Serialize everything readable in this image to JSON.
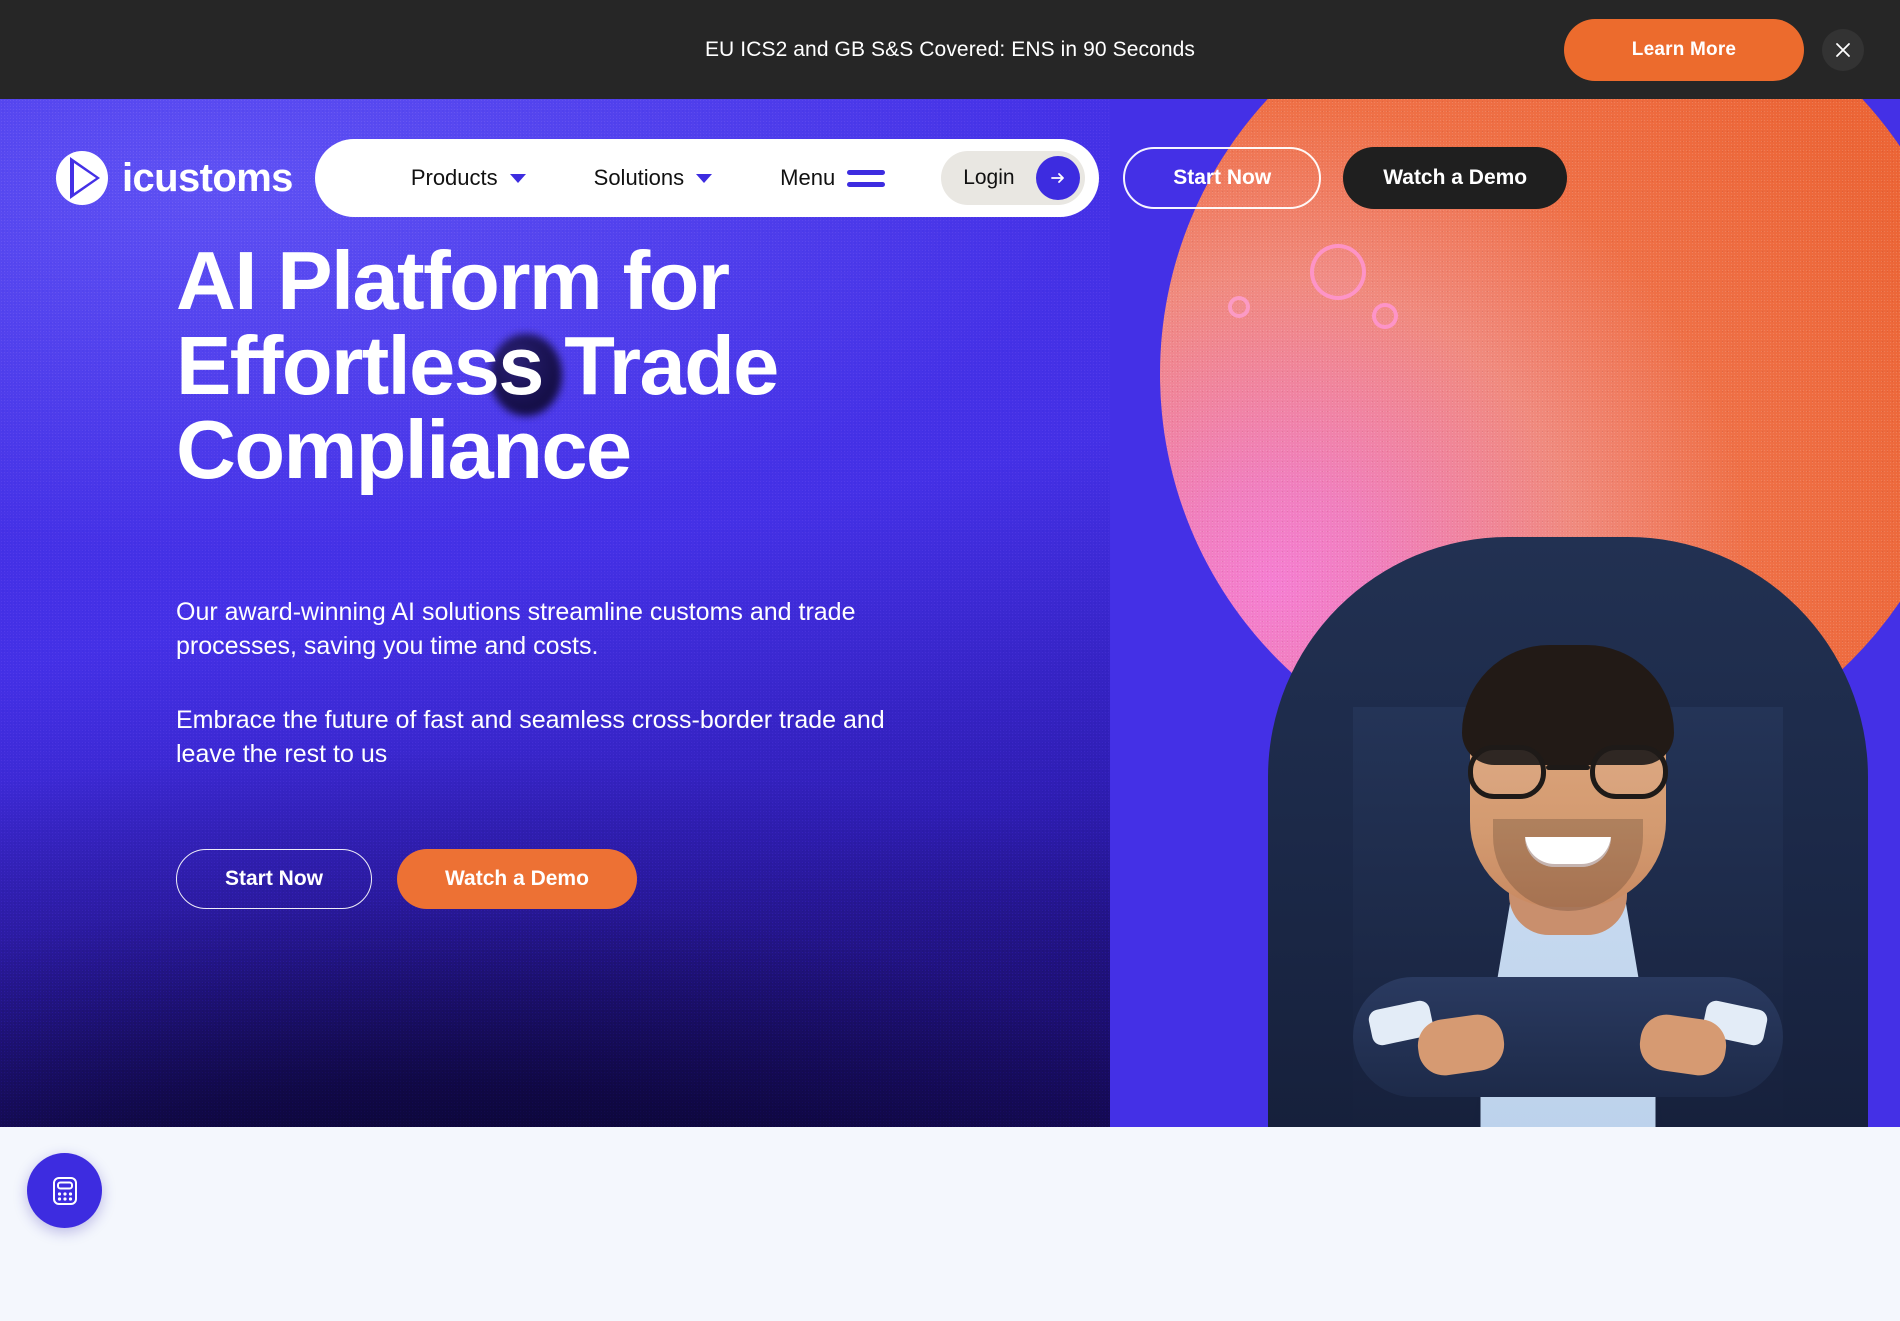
{
  "banner": {
    "message": "EU ICS2 and GB S&S Covered: ENS in 90 Seconds",
    "cta_label": "Learn More",
    "close_icon": "close-icon",
    "background_color": "#262626",
    "cta_color": "#ec6b2d"
  },
  "nav": {
    "logo_text": "icustoms",
    "logo_icon": "icustoms-logo-mark",
    "items": [
      {
        "label": "Products",
        "has_dropdown": true,
        "icon": "chevron-down-icon"
      },
      {
        "label": "Solutions",
        "has_dropdown": true,
        "icon": "chevron-down-icon"
      },
      {
        "label": "Menu",
        "has_dropdown": false,
        "icon": "hamburger-icon"
      }
    ],
    "login": {
      "label": "Login",
      "icon": "arrow-right-icon"
    },
    "start_now_label": "Start Now",
    "watch_demo_label": "Watch a Demo",
    "accent_color": "#3d2ce0"
  },
  "hero": {
    "title_lines": [
      "AI Platform for",
      "Effortless Trade",
      "Compliance"
    ],
    "title": "AI Platform for Effortless Trade Compliance",
    "paragraph_1": "Our award-winning AI solutions streamline customs and trade processes, saving you time and costs.",
    "paragraph_2": "Embrace the future of fast and seamless cross-border trade and leave the rest to us",
    "cta_primary_label": "Watch a Demo",
    "cta_secondary_label": "Start Now",
    "background_color": "#4430e6",
    "orange_color": "#ed7134"
  },
  "floating": {
    "widget_icon": "calculator-icon",
    "widget_color": "#3d2ce0"
  }
}
